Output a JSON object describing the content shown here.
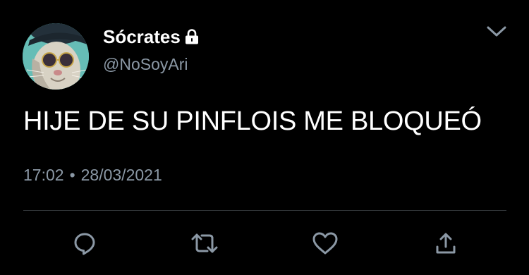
{
  "tweet": {
    "display_name": "Sócrates",
    "handle": "@NoSoyAri",
    "text": "HIJE DE SU PINFLOIS ME BLOQUEÓ",
    "time": "17:02",
    "separator": "•",
    "date": "28/03/2021"
  },
  "icons": {
    "avatar": "avatar-image",
    "lock": "lock-icon",
    "menu": "chevron-down-icon",
    "reply": "reply-bubble-icon",
    "retweet": "retweet-icon",
    "like": "heart-icon",
    "share": "share-icon"
  },
  "colors": {
    "background": "#000000",
    "primary_text": "#ffffff",
    "secondary_text": "#8b98a5",
    "divider": "#2f3336",
    "icon": "#8b98a5"
  }
}
